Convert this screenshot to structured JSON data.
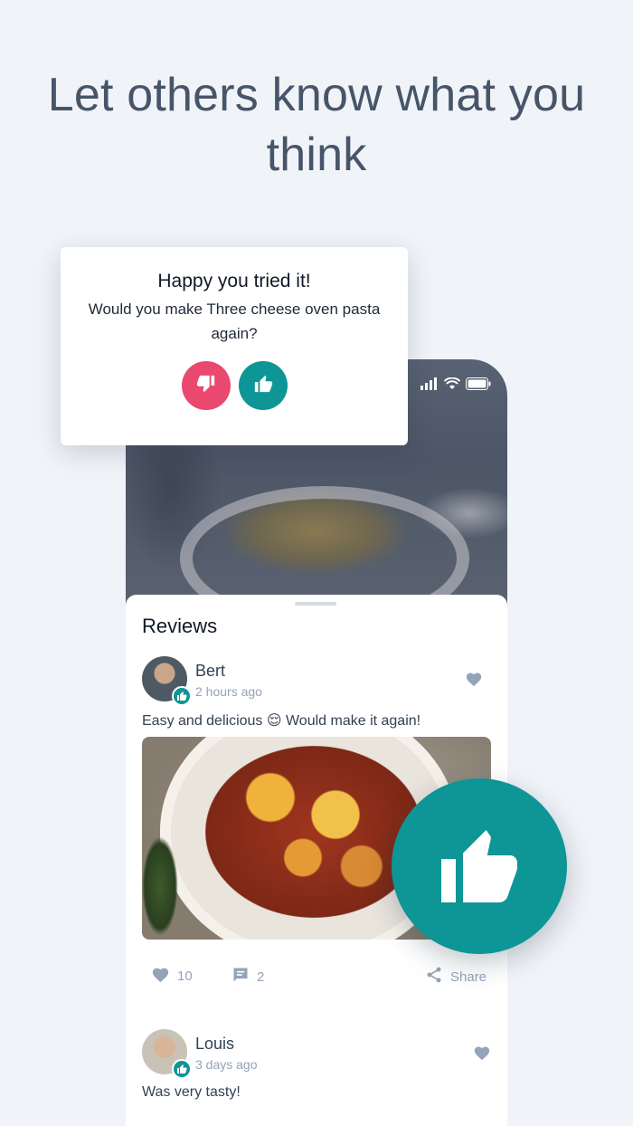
{
  "headline": "Let others know what you think",
  "popup": {
    "title": "Happy you tried it!",
    "question": "Would you make Three cheese oven pasta again?"
  },
  "reviews": {
    "title": "Reviews",
    "items": [
      {
        "name": "Bert",
        "time": "2 hours ago",
        "text": "Easy and delicious 😌 Would make it again!",
        "likes": "10",
        "comments": "2",
        "share_label": "Share"
      },
      {
        "name": "Louis",
        "time": "3 days ago",
        "text": "Was very tasty!"
      }
    ]
  },
  "colors": {
    "accent": "#0e9596",
    "negative": "#e9486f",
    "background": "#f0f3f8",
    "headline": "#475569"
  },
  "icons": {
    "thumbs_down": "thumbs-down-icon",
    "thumbs_up": "thumbs-up-icon",
    "heart": "heart-icon",
    "comment": "comment-icon",
    "share": "share-icon",
    "signal": "signal-icon",
    "wifi": "wifi-icon",
    "battery": "battery-icon"
  }
}
